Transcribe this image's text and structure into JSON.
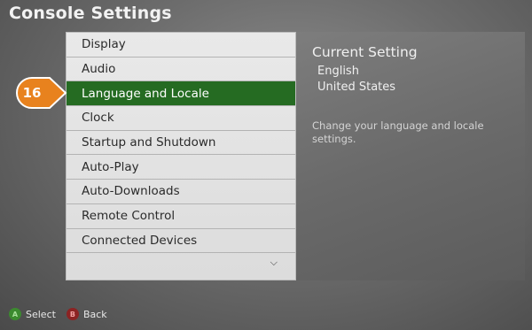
{
  "header": {
    "title": "Console Settings"
  },
  "menu": {
    "items": [
      {
        "label": "Display"
      },
      {
        "label": "Audio"
      },
      {
        "label": "Language and Locale"
      },
      {
        "label": "Clock"
      },
      {
        "label": "Startup and Shutdown"
      },
      {
        "label": "Auto-Play"
      },
      {
        "label": "Auto-Downloads"
      },
      {
        "label": "Remote Control"
      },
      {
        "label": "Connected Devices"
      }
    ],
    "selected": "Language and Locale",
    "more_icon": "chevron-down-icon"
  },
  "callout": {
    "number": "16",
    "color": "#e8821e"
  },
  "detail": {
    "heading": "Current Setting",
    "language": "English",
    "region": "United States",
    "description": "Change your language and locale settings."
  },
  "footer": {
    "a_glyph": "A",
    "a_label": "Select",
    "b_glyph": "B",
    "b_label": "Back"
  },
  "colors": {
    "selected_bg": "#256b22",
    "a_button": "#3c8a2f",
    "b_button": "#8c2323"
  }
}
